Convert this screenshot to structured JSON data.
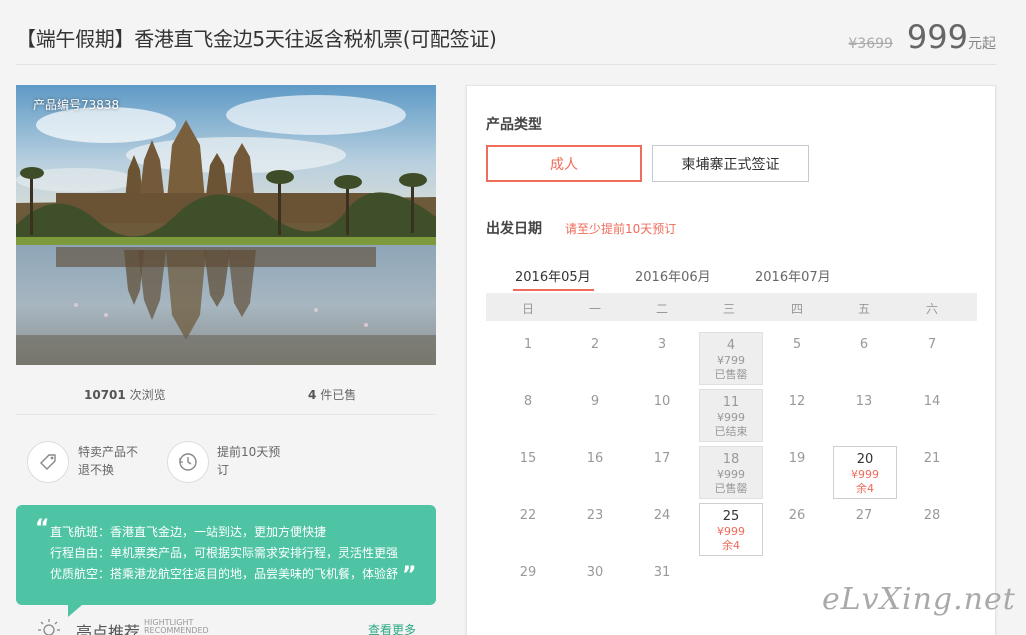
{
  "header": {
    "title": "【端午假期】香港直飞金边5天往返含税机票(可配签证)",
    "old_price": "¥3699",
    "price": "999",
    "price_unit": "元起"
  },
  "gallery": {
    "product_code": "产品编号73838"
  },
  "stats": {
    "views_count": "10701",
    "views_label": "次浏览",
    "sold_count": "4",
    "sold_label": "件已售"
  },
  "features": [
    {
      "icon": "tag-icon",
      "text": "特卖产品不退不换"
    },
    {
      "icon": "clock-icon",
      "text": "提前10天预订"
    }
  ],
  "highlights_box": {
    "quote_open": "“",
    "quote_close": "”",
    "lines": [
      "直飞航班：香港直飞金边，一站到达，更加方便快捷",
      "行程自由：单机票类产品，可根据实际需求安排行程，灵活性更强",
      "优质航空：搭乘港龙航空往返目的地，品尝美味的飞机餐，体验舒"
    ]
  },
  "highlight_bar": {
    "title": "亮点推荐",
    "subtitle_en_1": "HIGHTLIGHT",
    "subtitle_en_2": "RECOMMENDED",
    "more_link": "查看更多"
  },
  "booking": {
    "product_type_label": "产品类型",
    "types": [
      "成人",
      "柬埔寨正式签证"
    ],
    "selected_type": "成人",
    "date_label": "出发日期",
    "date_hint": "请至少提前10天预订",
    "months": [
      "2016年05月",
      "2016年06月",
      "2016年07月"
    ],
    "active_month": "2016年05月",
    "weekdays": [
      "日",
      "一",
      "二",
      "三",
      "四",
      "五",
      "六"
    ],
    "calendar_days": [
      "1",
      "2",
      "3",
      "4",
      "5",
      "6",
      "7",
      "8",
      "9",
      "10",
      "11",
      "12",
      "13",
      "14",
      "15",
      "16",
      "17",
      "18",
      "19",
      "20",
      "21",
      "22",
      "23",
      "24",
      "25",
      "26",
      "27",
      "28",
      "29",
      "30",
      "31"
    ],
    "day_cells": {
      "d4": {
        "day": "4",
        "price": "¥799",
        "status": "已售罄"
      },
      "d11": {
        "day": "11",
        "price": "¥999",
        "status": "已结束"
      },
      "d18": {
        "day": "18",
        "price": "¥999",
        "status": "已售罄"
      },
      "d20": {
        "day": "20",
        "price": "¥999",
        "status": "余4"
      },
      "d25": {
        "day": "25",
        "price": "¥999",
        "status": "余4"
      }
    }
  },
  "watermark": "eLvXing.net",
  "colors": {
    "accent": "#ef6b5b",
    "green": "#4ec4a5",
    "background": "#f4f4f4"
  }
}
